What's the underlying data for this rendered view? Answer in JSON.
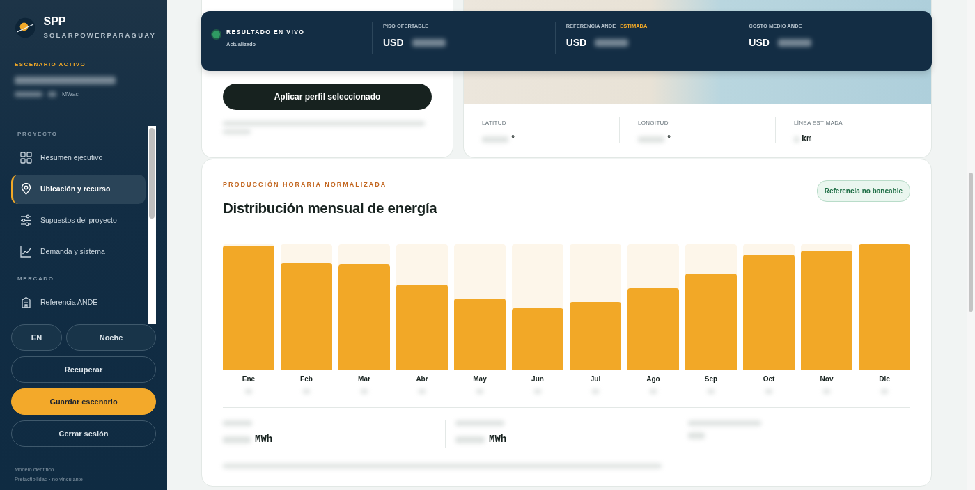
{
  "sidebar": {
    "brand": {
      "name": "SPP",
      "tagline": "SOLARPOWERPARAGUAY"
    },
    "active_scenario": {
      "label": "ESCENARIO ACTIVO",
      "unit": "MWac"
    },
    "sections": [
      {
        "title": "PROYECTO",
        "items": [
          {
            "label": "Resumen ejecutivo",
            "selected": false
          },
          {
            "label": "Ubicación y recurso",
            "selected": true
          },
          {
            "label": "Supuestos del proyecto",
            "selected": false
          },
          {
            "label": "Demanda y sistema",
            "selected": false
          }
        ]
      },
      {
        "title": "MERCADO",
        "items": [
          {
            "label": "Referencia ANDE",
            "selected": false
          }
        ]
      }
    ],
    "toggles": [
      "EN",
      "Noche"
    ],
    "buttons": [
      {
        "label": "Recuperar",
        "kind": "outline"
      },
      {
        "label": "Guardar escenario",
        "kind": "primary"
      },
      {
        "label": "Cerrar sesión",
        "kind": "outline"
      }
    ],
    "footer": [
      "Modelo científico",
      "Prefactibilidad · no vinculante"
    ]
  },
  "live_bar": {
    "status": {
      "title": "RESULTADO EN VIVO",
      "subtitle": "Actualizado",
      "live": true
    },
    "metrics": [
      {
        "label": "PISO OFERTABLE",
        "currency": "USD"
      },
      {
        "label": "REFERENCIA ANDE",
        "tag": "ESTIMADA",
        "currency": "USD"
      },
      {
        "label": "COSTO MEDIO ANDE",
        "currency": "USD"
      }
    ]
  },
  "profile_card": {
    "apply_button": "Aplicar perfil seleccionado"
  },
  "location_card": {
    "fields": [
      {
        "label": "LATITUD",
        "unit": "°"
      },
      {
        "label": "LONGITUD",
        "unit": "°"
      },
      {
        "label": "LÍNEA ESTIMADA",
        "unit": "km"
      }
    ]
  },
  "energy_card": {
    "eyebrow": "PRODUCCIÓN HORARIA NORMALIZADA",
    "title": "Distribución mensual de energía",
    "badge": "Referencia no bancable",
    "months": [
      {
        "label": "Ene",
        "level": 0.99
      },
      {
        "label": "Feb",
        "level": 0.85
      },
      {
        "label": "Mar",
        "level": 0.84
      },
      {
        "label": "Abr",
        "level": 0.68
      },
      {
        "label": "May",
        "level": 0.57
      },
      {
        "label": "Jun",
        "level": 0.49
      },
      {
        "label": "Jul",
        "level": 0.54
      },
      {
        "label": "Ago",
        "level": 0.65
      },
      {
        "label": "Sep",
        "level": 0.77
      },
      {
        "label": "Oct",
        "level": 0.92
      },
      {
        "label": "Nov",
        "level": 0.95
      },
      {
        "label": "Dic",
        "level": 1.0
      }
    ],
    "stat_units": [
      "MWh",
      "MWh"
    ]
  }
}
